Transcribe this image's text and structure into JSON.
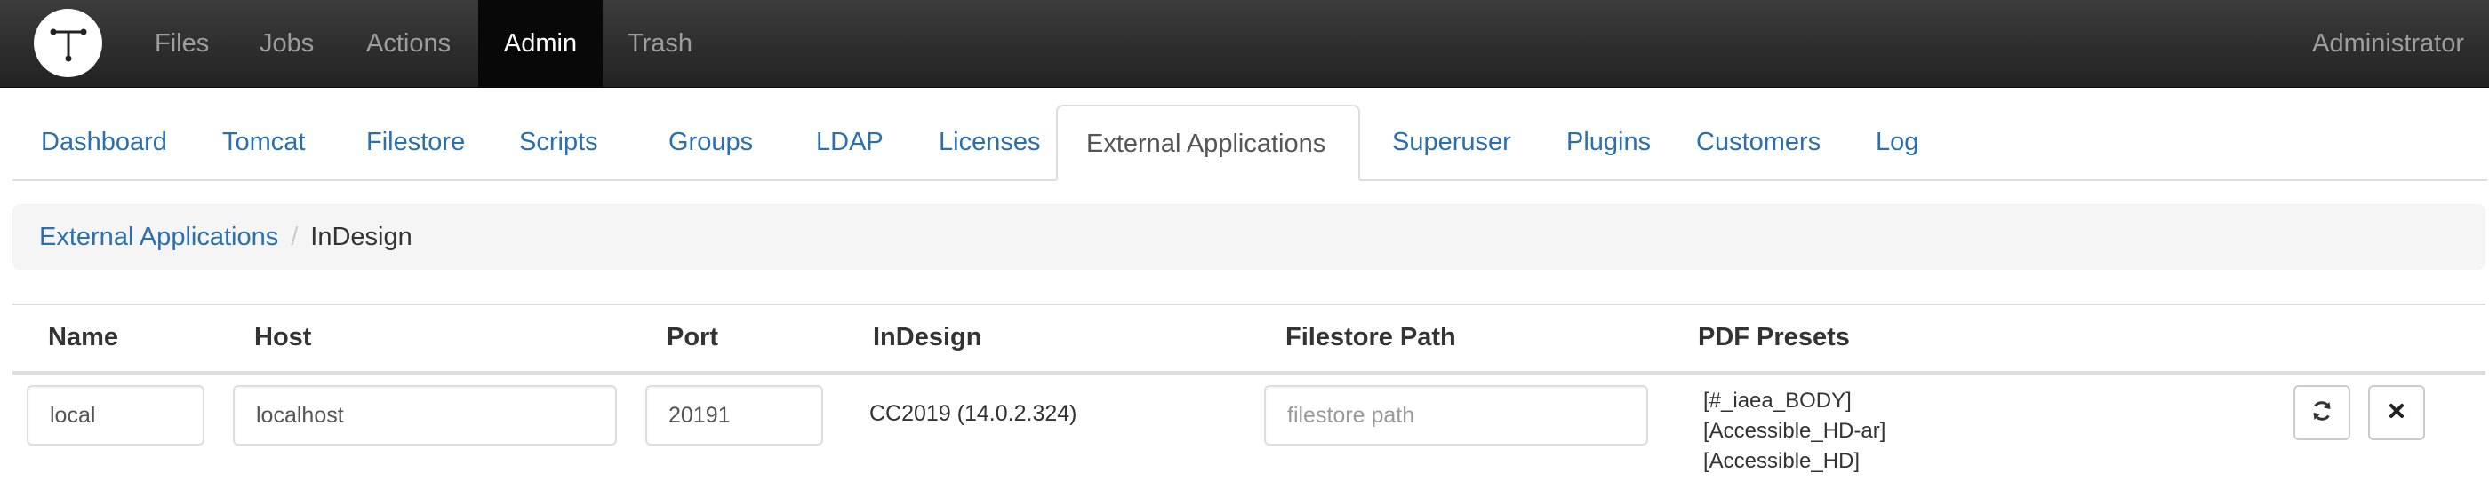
{
  "navbar": {
    "logo_icon": "t-logo-icon",
    "items": [
      {
        "label": "Files"
      },
      {
        "label": "Jobs"
      },
      {
        "label": "Actions"
      },
      {
        "label": "Admin",
        "active": true
      },
      {
        "label": "Trash"
      }
    ],
    "user": "Administrator"
  },
  "tabs": [
    {
      "label": "Dashboard"
    },
    {
      "label": "Tomcat"
    },
    {
      "label": "Filestore"
    },
    {
      "label": "Scripts"
    },
    {
      "label": "Groups"
    },
    {
      "label": "LDAP"
    },
    {
      "label": "Licenses"
    },
    {
      "label": "External Applications",
      "active": true
    },
    {
      "label": "Superuser"
    },
    {
      "label": "Plugins"
    },
    {
      "label": "Customers"
    },
    {
      "label": "Log"
    }
  ],
  "breadcrumb": {
    "parent": "External Applications",
    "separator": "/",
    "current": "InDesign"
  },
  "table": {
    "headers": {
      "name": "Name",
      "host": "Host",
      "port": "Port",
      "indesign": "InDesign",
      "filestore_path": "Filestore Path",
      "pdf_presets": "PDF Presets"
    },
    "row": {
      "name": "local",
      "host": "localhost",
      "port": "20191",
      "indesign": "CC2019 (14.0.2.324)",
      "filestore_path_placeholder": "filestore path",
      "pdf_presets": [
        "[#_iaea_BODY]",
        "[Accessible_HD-ar]",
        "[Accessible_HD]"
      ],
      "actions": {
        "refresh_icon": "refresh-icon",
        "delete_icon": "close-icon"
      }
    }
  },
  "colors": {
    "navbar_bg": "#222222",
    "link": "#2a6fae",
    "active_nav": "#080808"
  }
}
